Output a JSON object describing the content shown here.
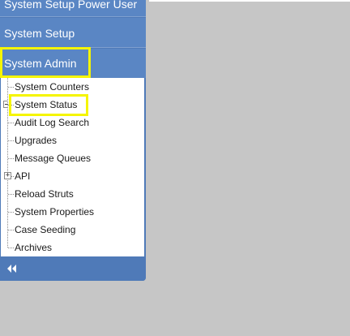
{
  "sidebar": {
    "menu": {
      "power_user": "System Setup Power User",
      "setup": "System Setup",
      "admin": "System Admin"
    },
    "tree": {
      "items": [
        {
          "label": "System Counters"
        },
        {
          "label": "System Status"
        },
        {
          "label": "Audit Log Search"
        },
        {
          "label": "Upgrades"
        },
        {
          "label": "Message Queues"
        },
        {
          "label": "API",
          "expander": "+"
        },
        {
          "label": "Reload Struts"
        },
        {
          "label": "System Properties"
        },
        {
          "label": "Case Seeding"
        },
        {
          "label": "Archives"
        }
      ]
    },
    "footer": {
      "collapse_icon": "double-chevron-left-icon"
    }
  },
  "colors": {
    "sidebar": "#4f7ab8",
    "menu_header": "#5a86c4",
    "highlight": "#f5f500",
    "background": "#c6c6c6"
  }
}
